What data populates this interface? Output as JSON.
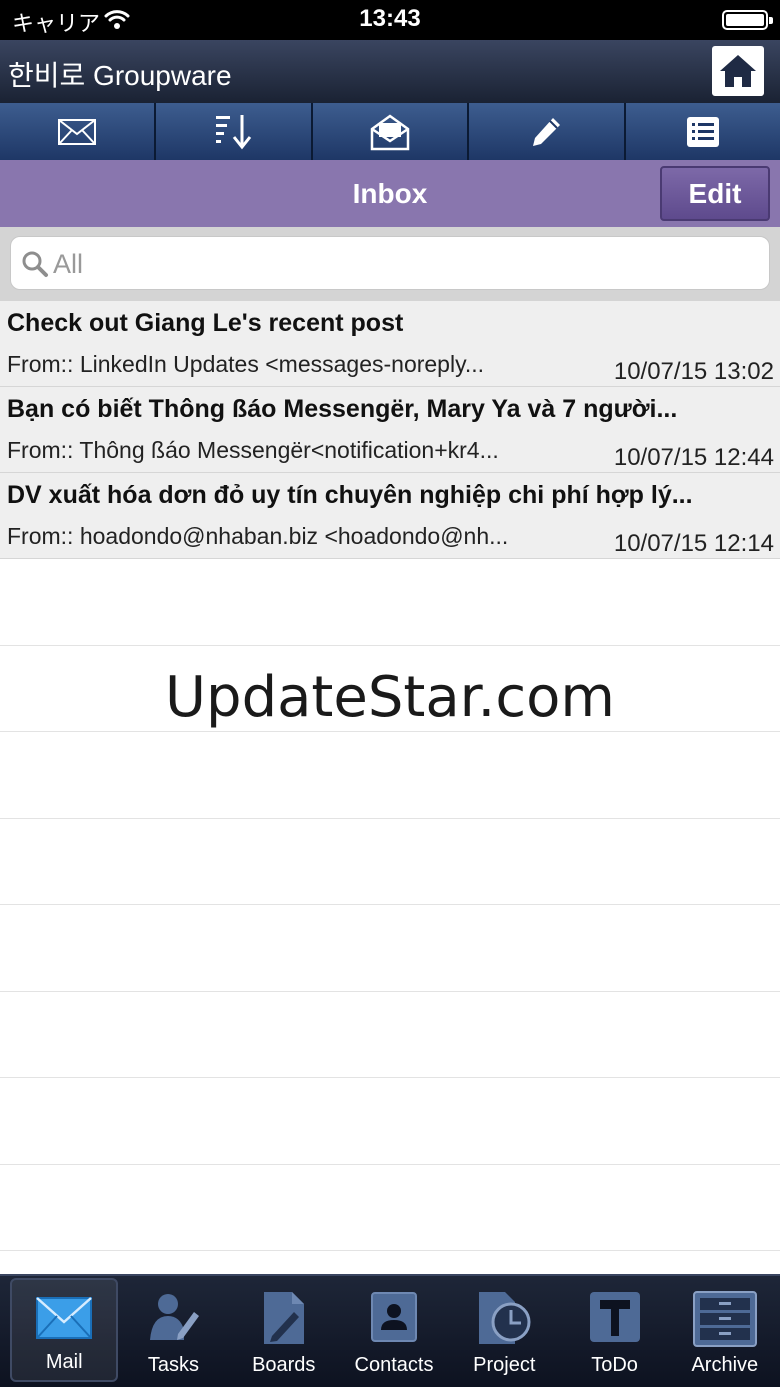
{
  "status_bar": {
    "carrier": "キャリア",
    "time": "13:43"
  },
  "header": {
    "title": "한비로 Groupware"
  },
  "toolbar": {
    "buttons": [
      "mail-icon",
      "sort-icon",
      "open-mail-icon",
      "compose-icon",
      "list-icon"
    ]
  },
  "nav": {
    "title": "Inbox",
    "edit_label": "Edit"
  },
  "search": {
    "placeholder": "All"
  },
  "messages": [
    {
      "subject": "Check out Giang Le's recent post",
      "from": "From:: LinkedIn Updates <messages-noreply...",
      "date": "10/07/15 13:02"
    },
    {
      "subject": "Bạn có biết Thông ßáo Messengër, Mary Ya và 7 người...",
      "from": "From:: Thông ßáo Messengër<notification+kr4...",
      "date": "10/07/15 12:44"
    },
    {
      "subject": "DV xuất hóa dơn đỏ uy tín chuyên nghiệp chi phí hợp lý...",
      "from": "From:: hoadondo@nhaban.biz <hoadondo@nh...",
      "date": "10/07/15 12:14"
    }
  ],
  "watermark": "UpdateStar.com",
  "tabs": [
    {
      "label": "Mail",
      "icon": "mail-icon",
      "active": true
    },
    {
      "label": "Tasks",
      "icon": "tasks-icon"
    },
    {
      "label": "Boards",
      "icon": "boards-icon"
    },
    {
      "label": "Contacts",
      "icon": "contacts-icon"
    },
    {
      "label": "Project",
      "icon": "project-icon"
    },
    {
      "label": "ToDo",
      "icon": "todo-icon"
    },
    {
      "label": "Archive",
      "icon": "archive-icon"
    }
  ],
  "colors": {
    "nav_bar": "#8976ae",
    "toolbar": "#2e4a7c",
    "header": "#2a3348",
    "tab_bar": "#151b2a"
  }
}
